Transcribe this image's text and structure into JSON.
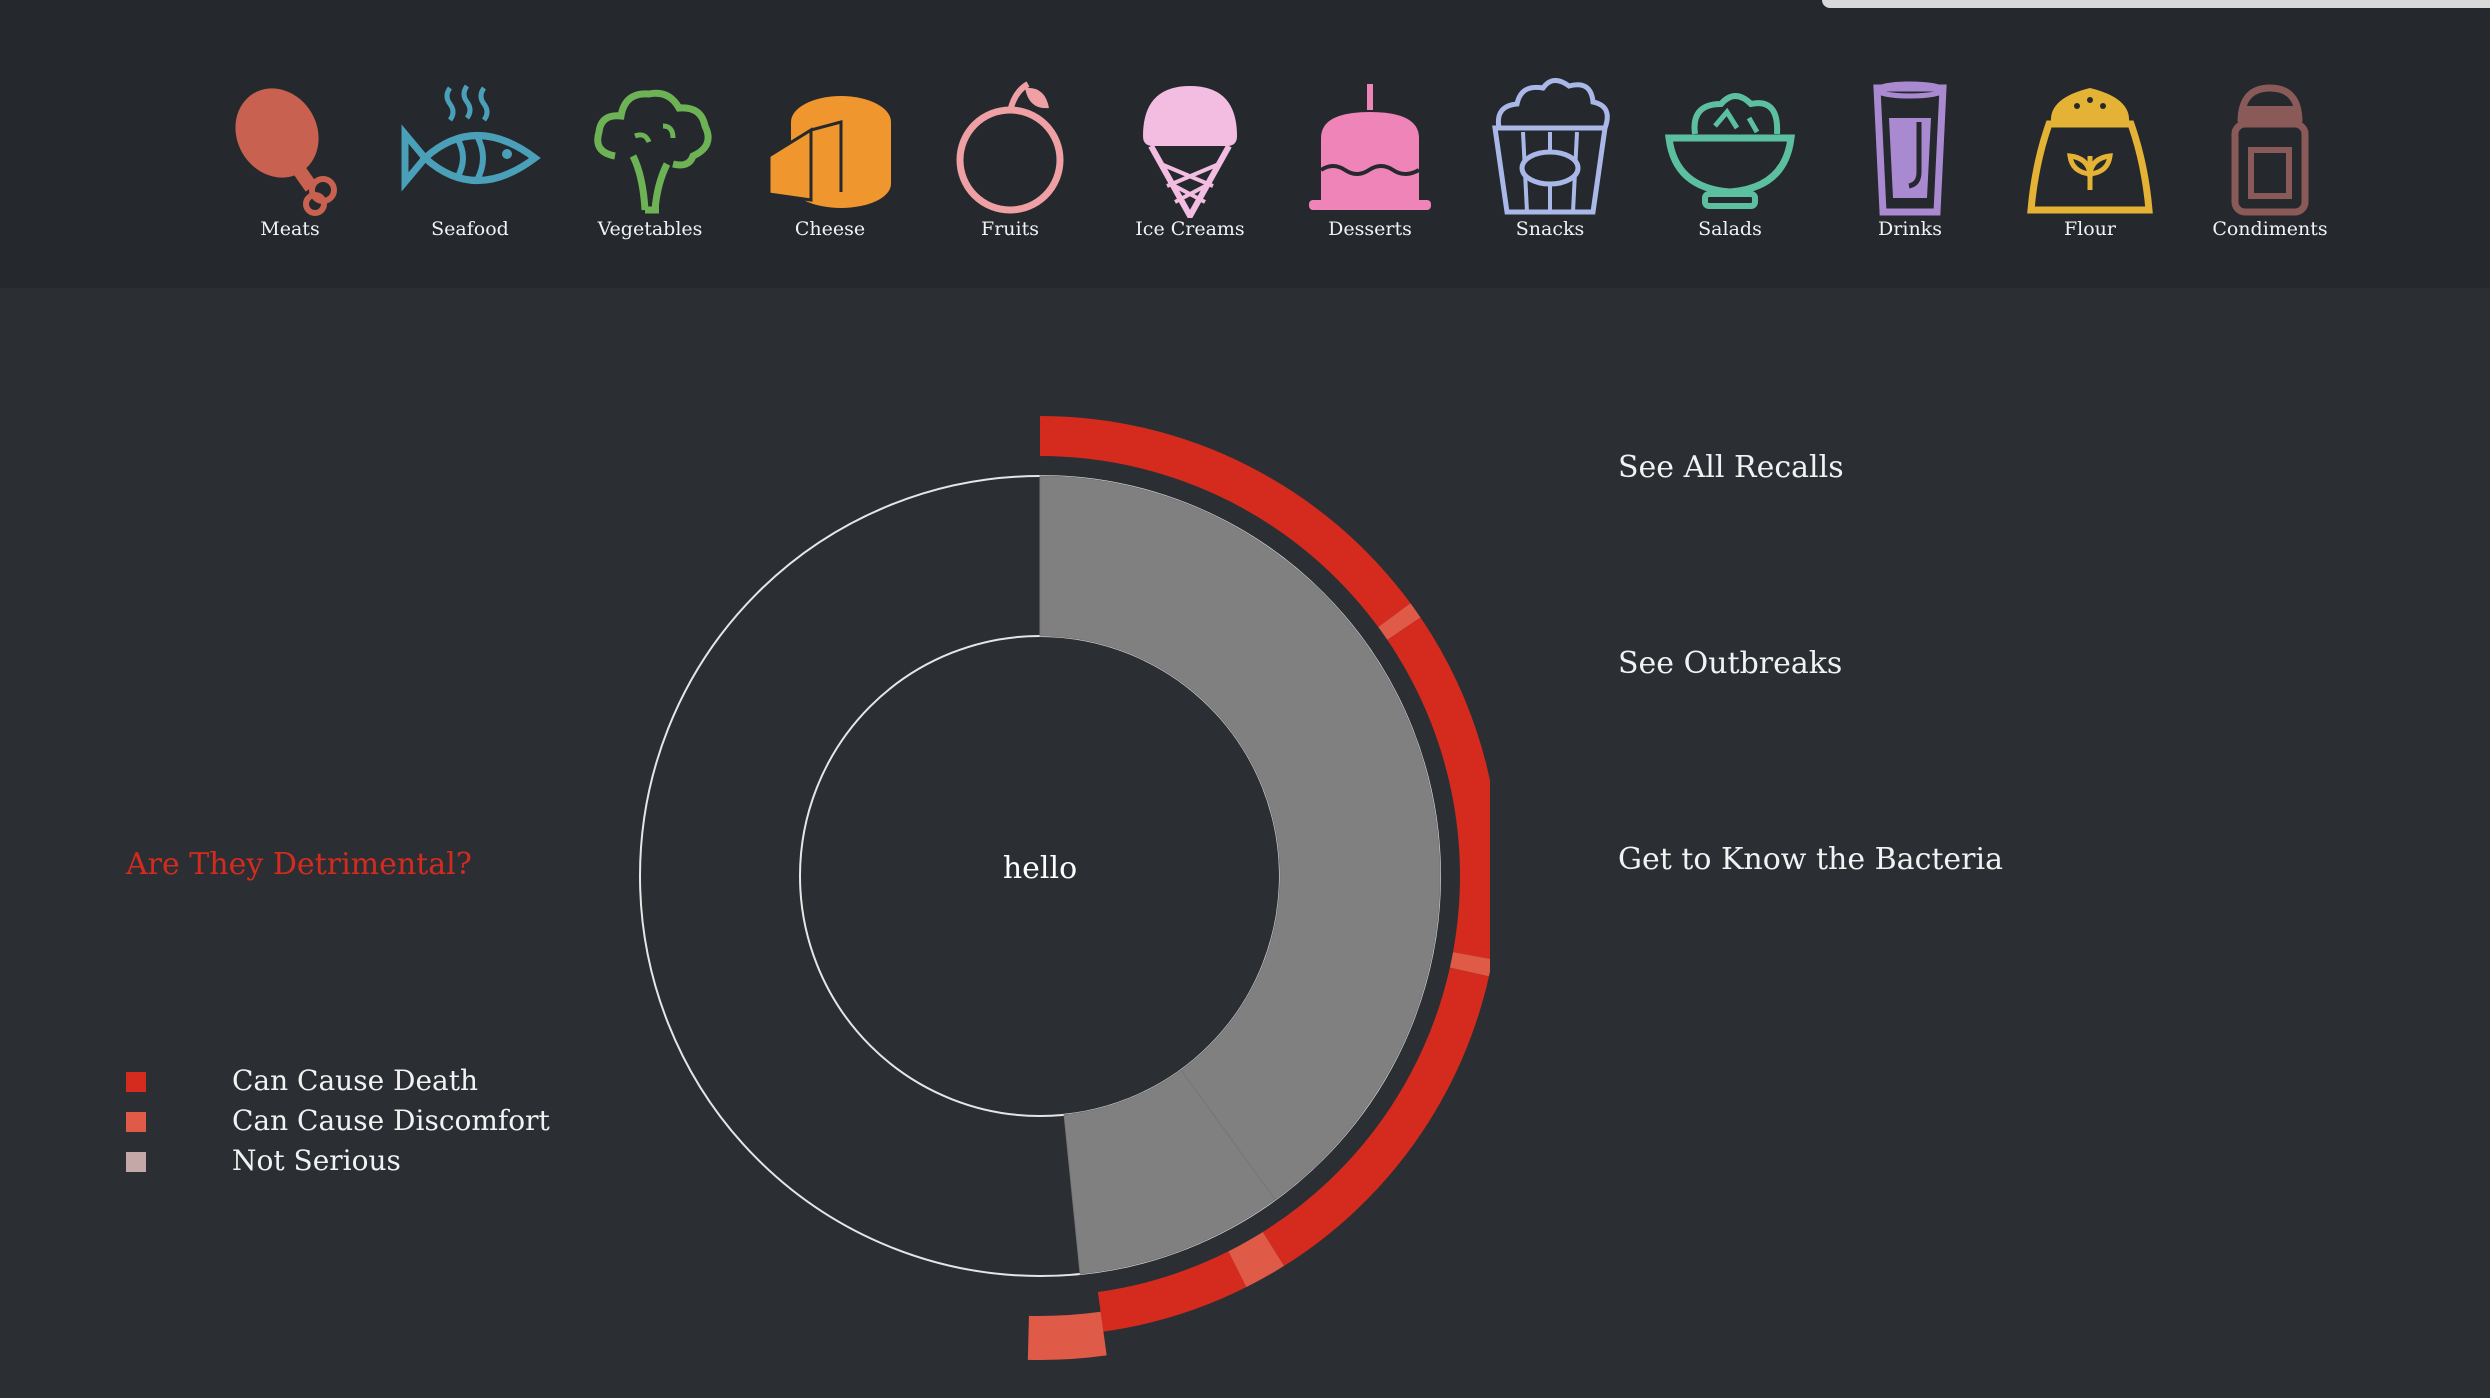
{
  "top_nav": {
    "categories": [
      {
        "label": "Meats",
        "icon": "drumstick-icon",
        "color": "#c8614f"
      },
      {
        "label": "Seafood",
        "icon": "fish-icon",
        "color": "#4aa0b8"
      },
      {
        "label": "Vegetables",
        "icon": "broccoli-icon",
        "color": "#6db356"
      },
      {
        "label": "Cheese",
        "icon": "cheese-icon",
        "color": "#f0962e"
      },
      {
        "label": "Fruits",
        "icon": "apple-icon",
        "color": "#eea0a4"
      },
      {
        "label": "Ice Creams",
        "icon": "ice-cream-icon",
        "color": "#f2bde0"
      },
      {
        "label": "Desserts",
        "icon": "cake-icon",
        "color": "#ef84b8"
      },
      {
        "label": "Snacks",
        "icon": "popcorn-icon",
        "color": "#aab8e8"
      },
      {
        "label": "Salads",
        "icon": "salad-bowl-icon",
        "color": "#5cc0a0"
      },
      {
        "label": "Drinks",
        "icon": "drink-glass-icon",
        "color": "#a98ad0"
      },
      {
        "label": "Flour",
        "icon": "flour-sack-icon",
        "color": "#e4b234"
      },
      {
        "label": "Condiments",
        "icon": "condiment-jar-icon",
        "color": "#8a5a58"
      }
    ]
  },
  "question": {
    "label": "Are They Detrimental?",
    "color": "#d52b1e"
  },
  "legend": [
    {
      "label": "Can Cause Death",
      "color": "#d52b1e"
    },
    {
      "label": "Can Cause Discomfort",
      "color": "#e05a48"
    },
    {
      "label": "Not Serious",
      "color": "#c4a8a8"
    }
  ],
  "chart_data": {
    "type": "sunburst",
    "center_label": "hello",
    "inner_ring": {
      "color": "#808080",
      "segments": [
        {
          "value": 40.0
        },
        {
          "value": 8.4
        }
      ]
    },
    "outer_ring": {
      "segments": [
        {
          "value": 14.9,
          "severity": "Can Cause Death"
        },
        {
          "value": 0.6,
          "severity": "Can Cause Discomfort"
        },
        {
          "value": 12.4,
          "severity": "Can Cause Death"
        },
        {
          "value": 0.6,
          "severity": "Can Cause Discomfort"
        },
        {
          "value": 12.6,
          "severity": "Can Cause Death"
        },
        {
          "value": 1.5,
          "severity": "Can Cause Discomfort"
        },
        {
          "value": 5.2,
          "severity": "Can Cause Death"
        },
        {
          "value": 2.6,
          "severity": "Can Cause Discomfort"
        }
      ]
    },
    "total": 100
  },
  "links": [
    {
      "label": "See All Recalls"
    },
    {
      "label": "See Outbreaks"
    },
    {
      "label": "Get to Know the Bacteria"
    }
  ]
}
